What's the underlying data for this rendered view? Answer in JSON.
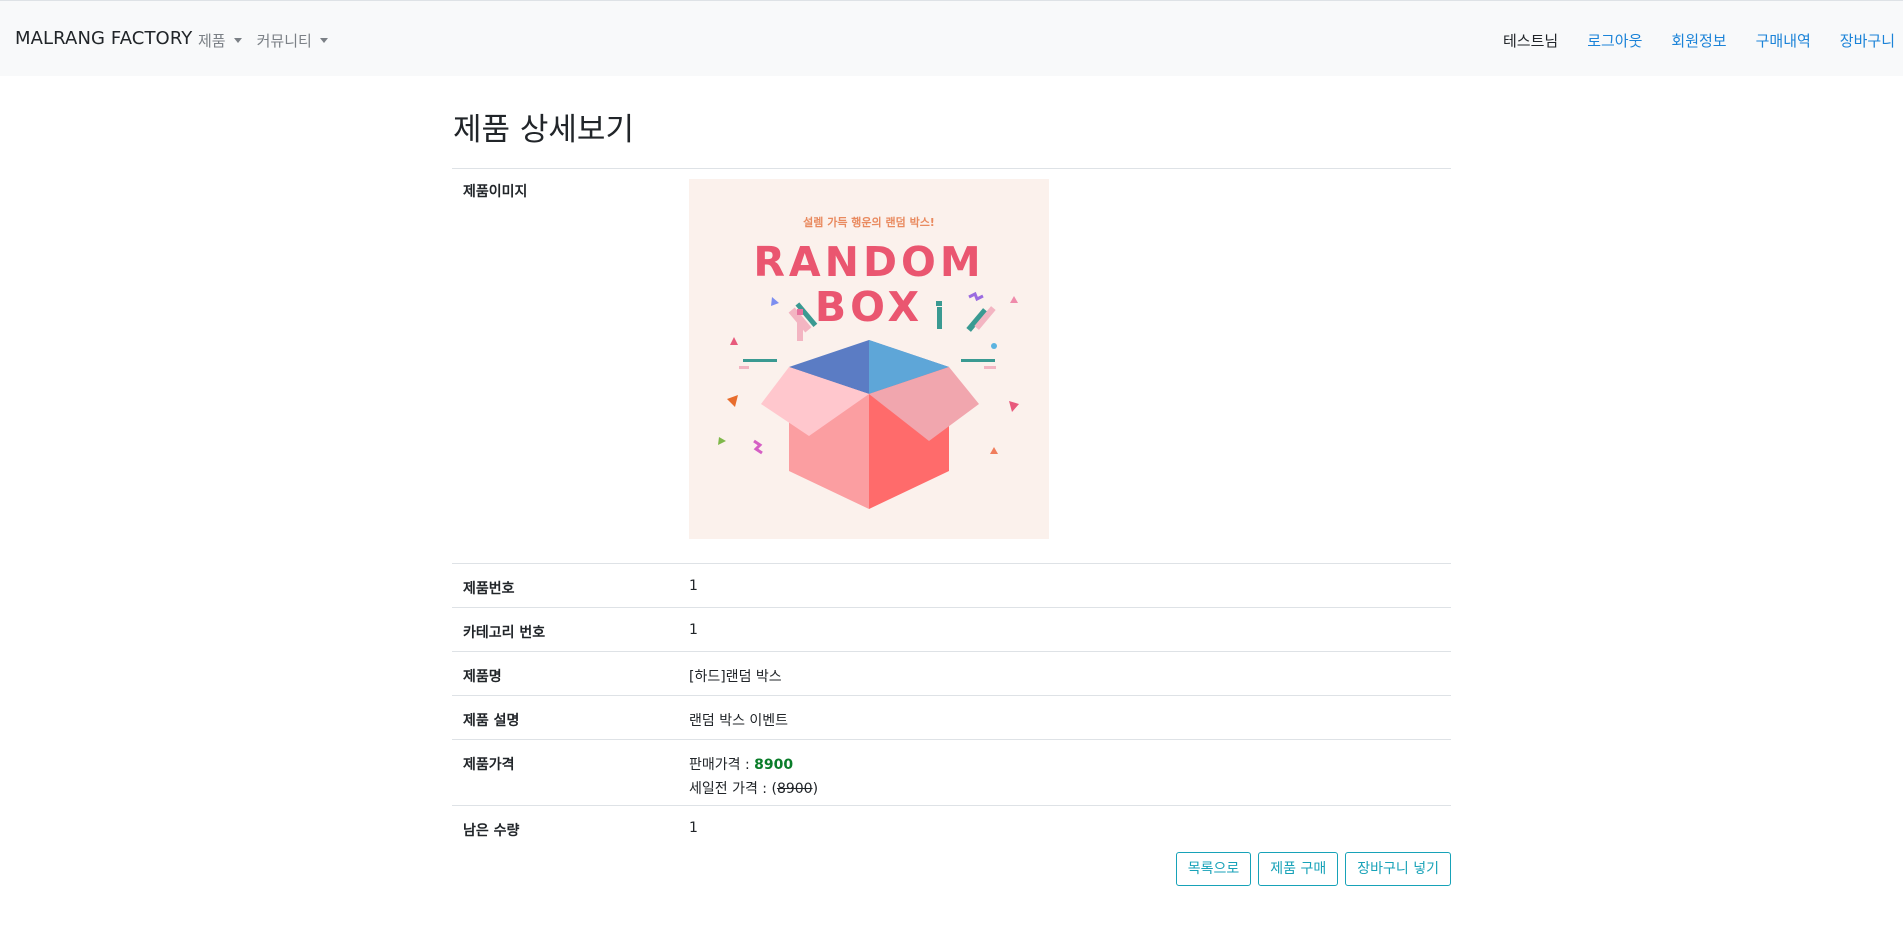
{
  "navbar": {
    "brand": "MALRANG FACTORY",
    "menus": [
      "제품",
      "커뮤니티"
    ],
    "user": "테스트님",
    "links": [
      "로그아웃",
      "회원정보",
      "구매내역",
      "장바구니"
    ]
  },
  "page": {
    "title": "제품 상세보기"
  },
  "product": {
    "image_label": "제품이미지",
    "image_text": {
      "tagline": "설렘 가득 행운의 랜덤 박스!",
      "line1": "RANDOM",
      "line2": "BOX"
    },
    "rows": [
      {
        "label": "제품번호",
        "value": "1"
      },
      {
        "label": "카테고리 번호",
        "value": "1"
      },
      {
        "label": "제품명",
        "value": "[하드]랜덤 박스"
      },
      {
        "label": "제품 설명",
        "value": "랜덤 박스 이벤트"
      }
    ],
    "price": {
      "label": "제품가격",
      "sale_label": "판매가격 :",
      "sale_value": "8900",
      "orig_label": "세일전 가격 :",
      "orig_open": "(",
      "orig_value": "8900",
      "orig_close": ")"
    },
    "stock": {
      "label": "남은 수량",
      "value": "1"
    }
  },
  "buttons": {
    "list": "목록으로",
    "buy": "제품 구매",
    "cart": "장바구니 넣기"
  },
  "colors": {
    "link": "#1b83d8",
    "sale": "#0a7d2a",
    "button": "#17a2b8",
    "image_bg": "#fbf1ec",
    "title_pink": "#ea5670"
  }
}
